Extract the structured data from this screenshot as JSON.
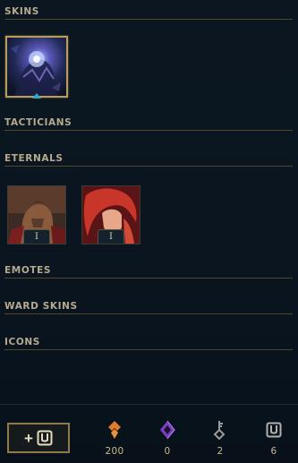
{
  "sections": {
    "skins": "SKINS",
    "tacticians": "TACTICIANS",
    "eternals": "ETERNALS",
    "emotes": "EMOTES",
    "ward_skins": "WARD SKINS",
    "icons": "ICONS"
  },
  "skins": [
    {
      "name": "skin-tile",
      "selected": true
    }
  ],
  "eternals": [
    {
      "badge": "I"
    },
    {
      "badge": "I"
    }
  ],
  "footer": {
    "add_button_icons": [
      "plus-icon",
      "loot-chest-icon"
    ],
    "currencies": [
      {
        "icon": "orange-essence-icon",
        "amount": "200",
        "color": "#e07c2e"
      },
      {
        "icon": "mythic-essence-icon",
        "amount": "0",
        "color": "#a45ad8"
      },
      {
        "icon": "key-icon",
        "amount": "2",
        "color": "#8c8c8c"
      },
      {
        "icon": "chest-icon",
        "amount": "6",
        "color": "#a9a9a9"
      }
    ]
  },
  "colors": {
    "accent_gold": "#b89d5c",
    "selection_blue": "#32a6c8",
    "background": "#0b1620"
  }
}
